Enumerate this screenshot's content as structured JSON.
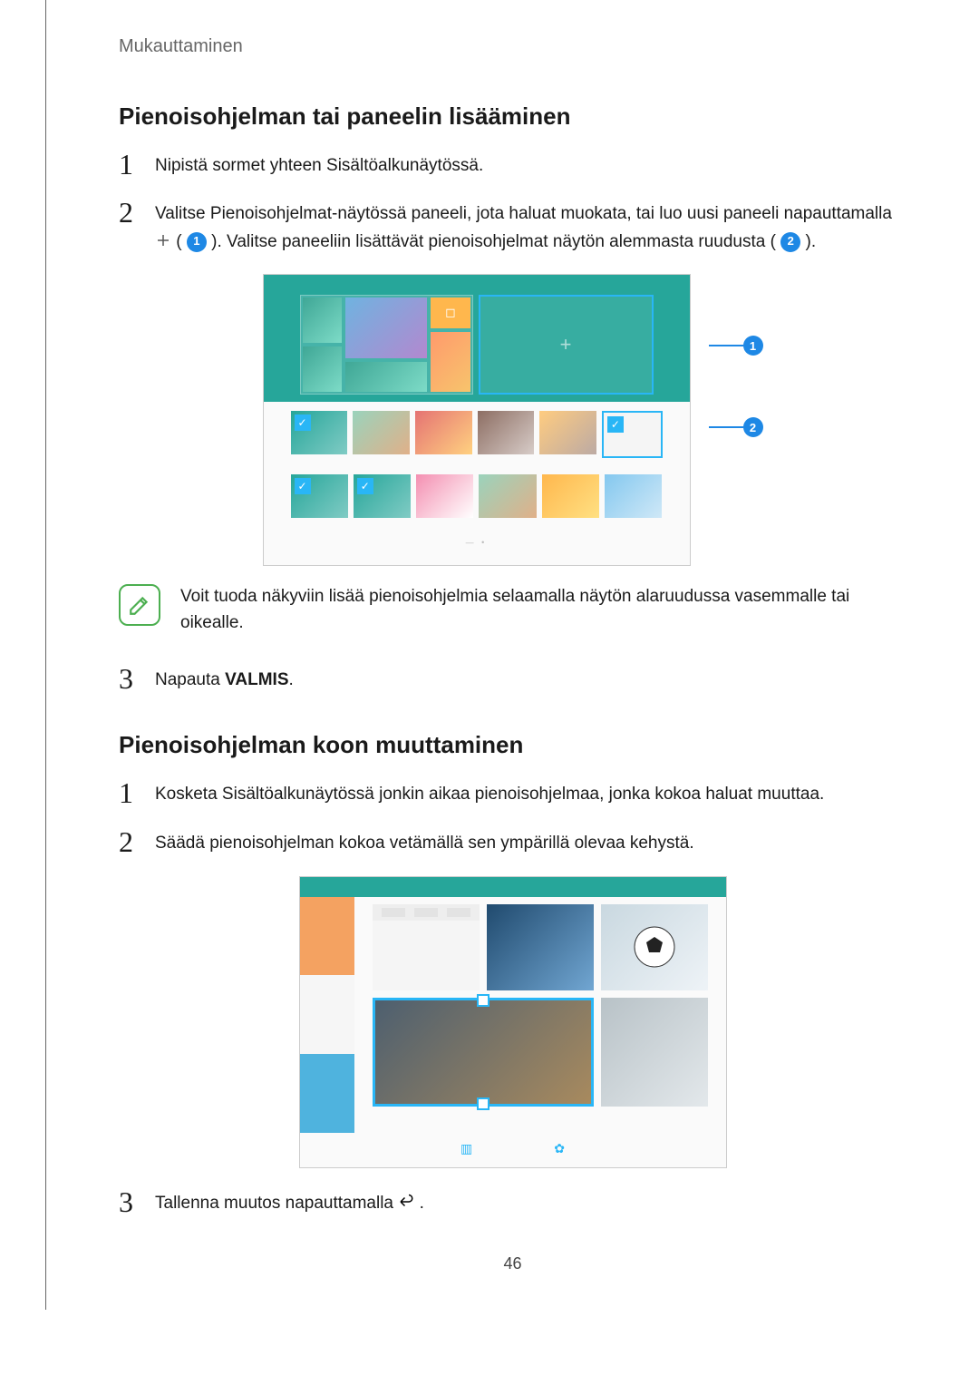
{
  "breadcrumb": "Mukauttaminen",
  "section1": {
    "title": "Pienoisohjelman tai paneelin lisääminen",
    "step1": "Nipistä sormet yhteen Sisältöalkunäytössä.",
    "step2_a": "Valitse Pienoisohjelmat-näytössä paneeli, jota haluat muokata, tai luo uusi paneeli napauttamalla ",
    "step2_b": " ( ",
    "step2_c": " ). Valitse paneeliin lisättävät pienoisohjelmat näytön alemmasta ruudusta ( ",
    "step2_d": " ).",
    "note": "Voit tuoda näkyviin lisää pienoisohjelmia selaamalla näytön alaruudussa vasemmalle tai oikealle.",
    "step3_a": "Napauta ",
    "step3_b": "VALMIS",
    "step3_c": "."
  },
  "section2": {
    "title": "Pienoisohjelman koon muuttaminen",
    "step1": "Kosketa Sisältöalkunäytössä jonkin aikaa pienoisohjelmaa, jonka kokoa haluat muuttaa.",
    "step2": "Säädä pienoisohjelman kokoa vetämällä sen ympärillä olevaa kehystä.",
    "step3_a": "Tallenna muutos napauttamalla ",
    "step3_b": "."
  },
  "callouts": {
    "c1": "1",
    "c2": "2"
  },
  "figure1_labels": {
    "r1": [
      "",
      "",
      "",
      "",
      "",
      ""
    ],
    "r2": [
      "",
      "",
      "",
      "",
      "",
      ""
    ]
  },
  "figure2_bottom": {
    "left": "",
    "right": ""
  },
  "page_number": "46"
}
